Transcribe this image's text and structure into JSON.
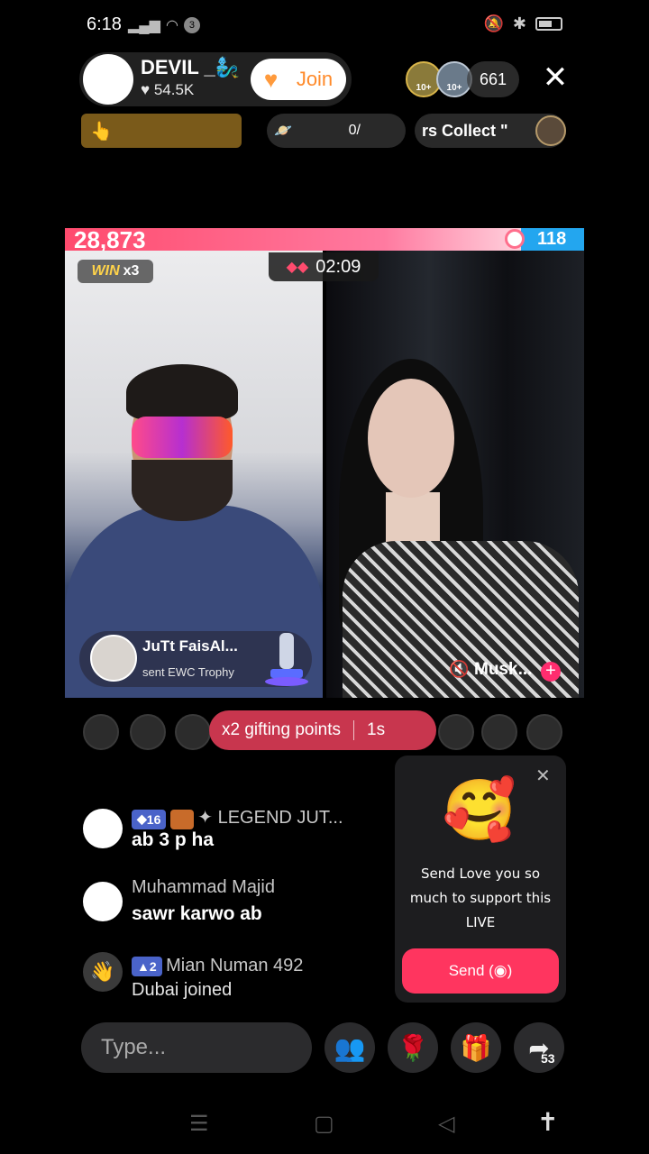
{
  "status": {
    "time": "6:18",
    "notif_count": "3"
  },
  "host": {
    "name": "DEVIL _🧞‍♂️",
    "likes": "♥ 54.5K",
    "join_label": "Join"
  },
  "viewers": {
    "badge1": "10+",
    "badge2": "10+",
    "count": "661"
  },
  "row2": {
    "progress": "0/",
    "collect": "rs   Collect \""
  },
  "battle": {
    "score_left": "28,873",
    "score_right": "118",
    "timer": "02:09",
    "win_label": "WIN",
    "win_mult": "x3"
  },
  "gift": {
    "sender": "JuTt FaisAl...",
    "text": "sent EWC Trophy"
  },
  "right_streamer": {
    "name": "Musk..."
  },
  "gifting": {
    "label": "x2 gifting points",
    "time": "1s"
  },
  "chat": [
    {
      "level": "16",
      "user": "LEGEND JUT...",
      "message": "ab 3 p ha"
    },
    {
      "user": "Muhammad Majid",
      "message": "sawr karwo ab"
    },
    {
      "level": "2",
      "user": "Mian Numan 492",
      "message": "Dubai joined"
    }
  ],
  "popup": {
    "line1": "Send Love you so",
    "line2": "much to support this",
    "line3": "LIVE",
    "send_label": "Send"
  },
  "bottom": {
    "type_placeholder": "Type...",
    "share_count": "53"
  }
}
